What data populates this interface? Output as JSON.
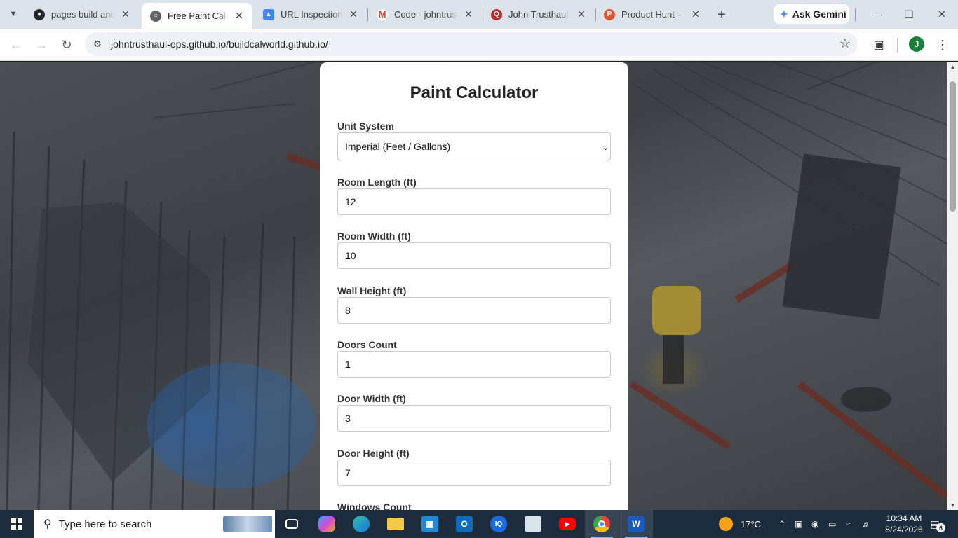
{
  "browser": {
    "tabs": [
      {
        "title": "pages build and d",
        "favicon": "github-icon",
        "active": false
      },
      {
        "title": "Free Paint Calcula",
        "favicon": "globe-icon",
        "active": true
      },
      {
        "title": "URL Inspection",
        "favicon": "search-console-icon",
        "active": false
      },
      {
        "title": "Code - johntrustl",
        "favicon": "gmail-icon",
        "active": false
      },
      {
        "title": "John Trusthaul Tr",
        "favicon": "quora-icon",
        "active": false
      },
      {
        "title": "Product Hunt – T",
        "favicon": "product-hunt-icon",
        "active": false
      }
    ],
    "ask_gemini": "Ask Gemini",
    "url": "johntrusthaul-ops.github.io/buildcalworld.github.io/",
    "profile_initial": "J"
  },
  "calculator": {
    "title": "Paint Calculator",
    "unit_system": {
      "label": "Unit System",
      "selected": "Imperial (Feet / Gallons)"
    },
    "fields": [
      {
        "label": "Room Length (ft)",
        "value": "12"
      },
      {
        "label": "Room Width (ft)",
        "value": "10"
      },
      {
        "label": "Wall Height (ft)",
        "value": "8"
      },
      {
        "label": "Doors Count",
        "value": "1"
      },
      {
        "label": "Door Width (ft)",
        "value": "3"
      },
      {
        "label": "Door Height (ft)",
        "value": "7"
      }
    ],
    "partial_label": "Windows Count"
  },
  "taskbar": {
    "search_placeholder": "Type here to search",
    "weather": "17°C",
    "time": "10:34 AM",
    "date": "8/24/2026",
    "notification_count": "6"
  },
  "colors": {
    "tabstrip_bg": "#dde3ea",
    "card_bg": "#ffffff",
    "taskbar_bg": "#1c2c3c",
    "background_photo": "#4c5055"
  }
}
